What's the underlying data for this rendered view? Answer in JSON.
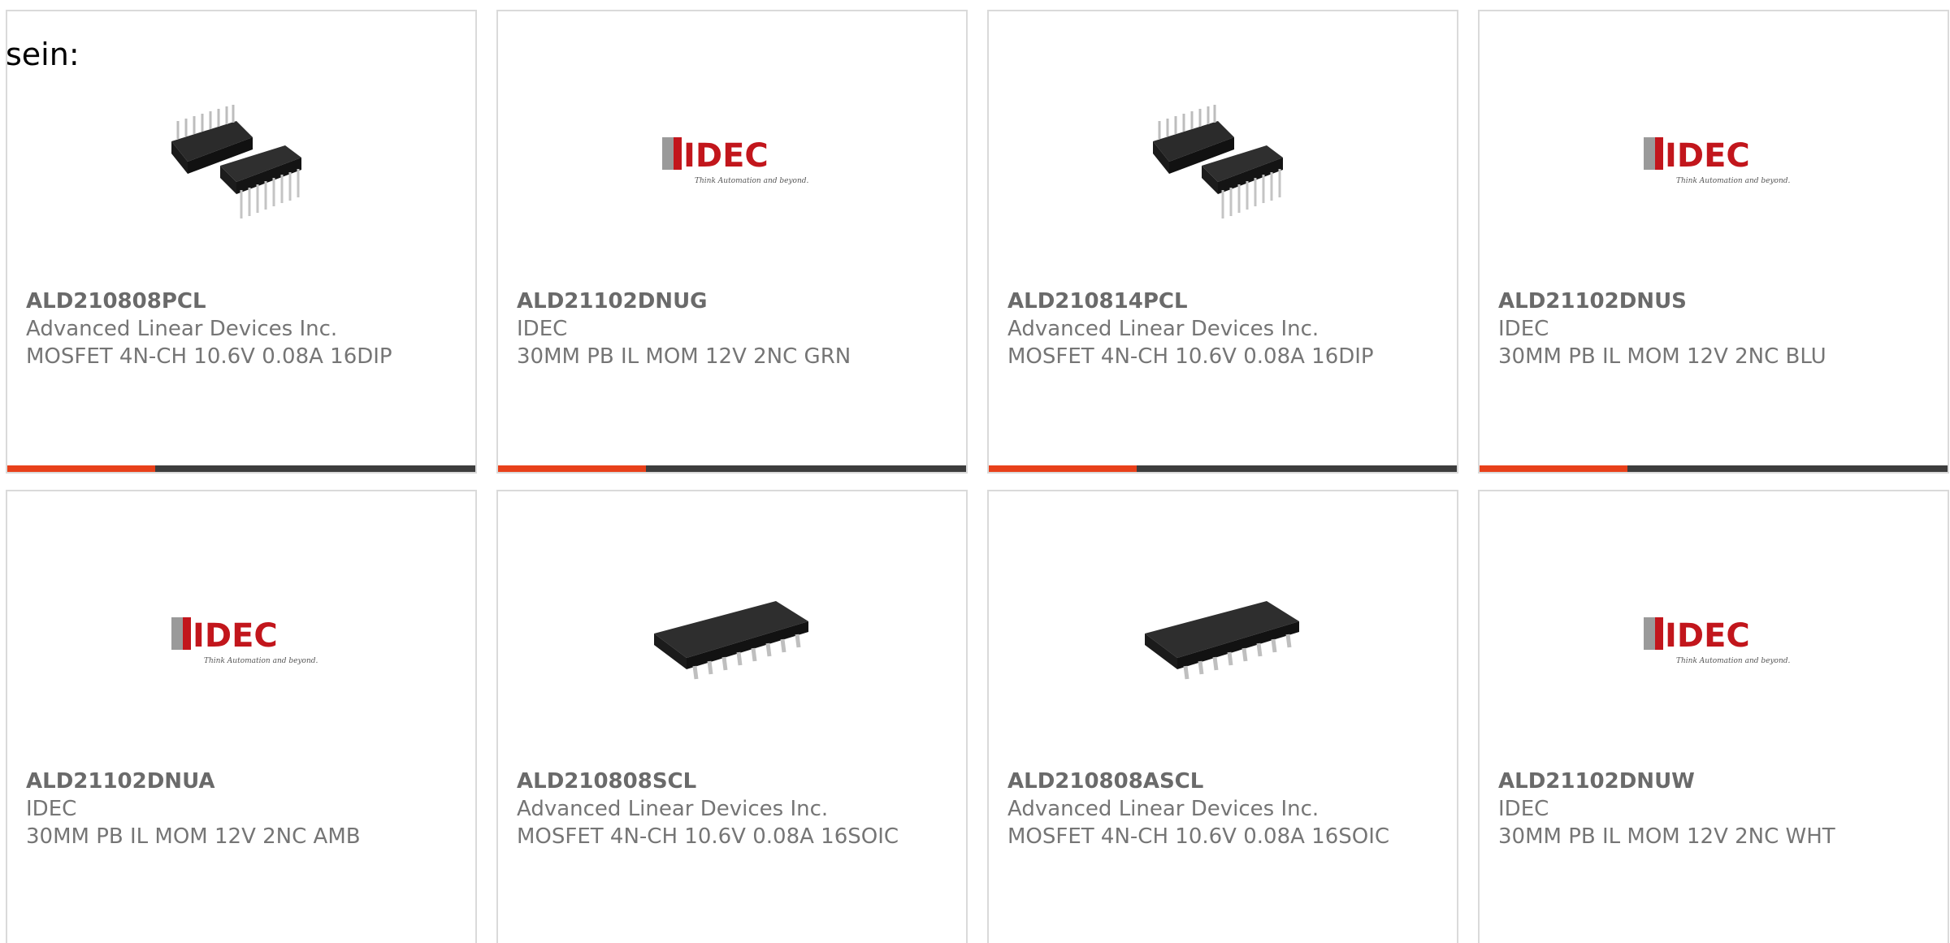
{
  "heading": "sein:",
  "colors": {
    "accent": "#e8401a",
    "bar_dark": "#3d3d3d",
    "idec_red": "#c2161c",
    "idec_gray": "#9a9a9a"
  },
  "products": [
    {
      "part": "ALD210808PCL",
      "manufacturer": "Advanced Linear Devices Inc.",
      "description": "MOSFET 4N-CH 10.6V 0.08A 16DIP",
      "image": "dip-chip-icon"
    },
    {
      "part": "ALD21102DNUG",
      "manufacturer": "IDEC",
      "description": "30MM PB IL MOM 12V 2NC GRN",
      "image": "idec-logo"
    },
    {
      "part": "ALD210814PCL",
      "manufacturer": "Advanced Linear Devices Inc.",
      "description": "MOSFET 4N-CH 10.6V 0.08A 16DIP",
      "image": "dip-chip-icon"
    },
    {
      "part": "ALD21102DNUS",
      "manufacturer": "IDEC",
      "description": "30MM PB IL MOM 12V 2NC BLU",
      "image": "idec-logo"
    },
    {
      "part": "ALD21102DNUA",
      "manufacturer": "IDEC",
      "description": "30MM PB IL MOM 12V 2NC AMB",
      "image": "idec-logo"
    },
    {
      "part": "ALD210808SCL",
      "manufacturer": "Advanced Linear Devices Inc.",
      "description": "MOSFET 4N-CH 10.6V 0.08A 16SOIC",
      "image": "soic-chip-icon"
    },
    {
      "part": "ALD210808ASCL",
      "manufacturer": "Advanced Linear Devices Inc.",
      "description": "MOSFET 4N-CH 10.6V 0.08A 16SOIC",
      "image": "soic-chip-icon"
    },
    {
      "part": "ALD21102DNUW",
      "manufacturer": "IDEC",
      "description": "30MM PB IL MOM 12V 2NC WHT",
      "image": "idec-logo"
    }
  ],
  "idec_logo": {
    "wordmark": "IDEC",
    "tagline": "Think Automation and beyond..."
  }
}
